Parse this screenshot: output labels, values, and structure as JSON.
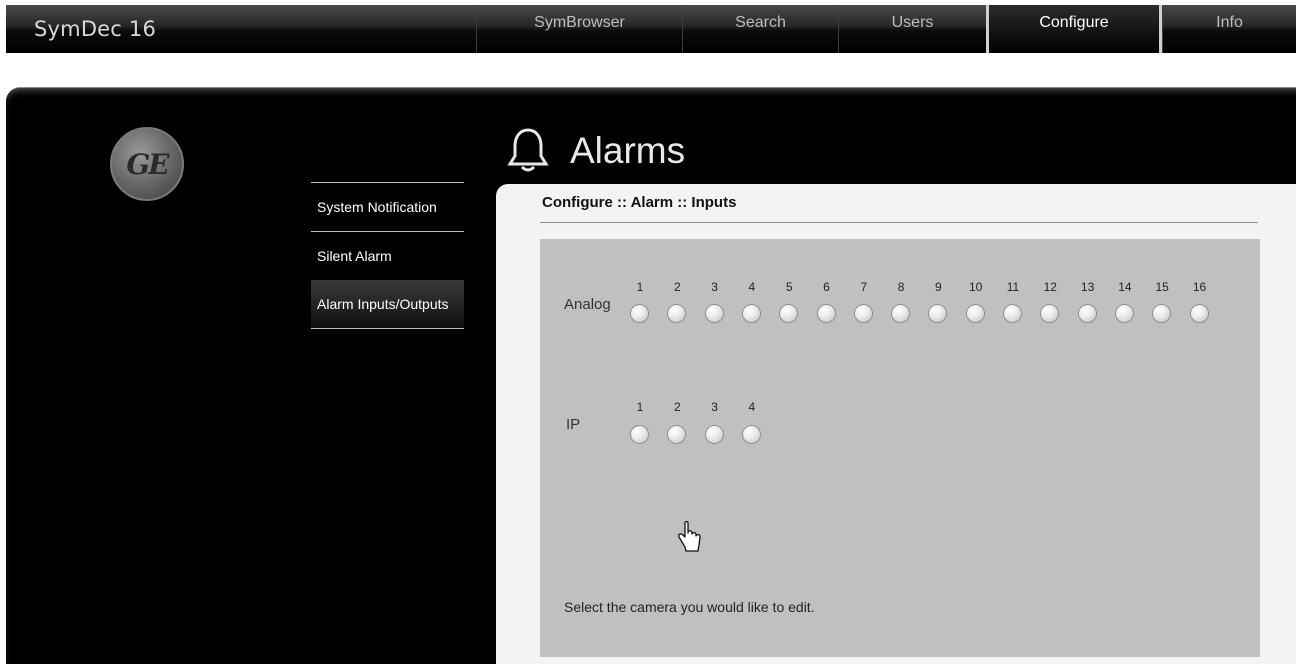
{
  "app": {
    "title": "SymDec 16"
  },
  "nav": {
    "tabs": [
      {
        "label": "SymBrowser"
      },
      {
        "label": "Search"
      },
      {
        "label": "Users"
      },
      {
        "label": "Configure",
        "active": true
      },
      {
        "label": "Info"
      }
    ]
  },
  "sidebar": {
    "items": [
      {
        "label": "System Notification"
      },
      {
        "label": "Silent Alarm"
      },
      {
        "label": "Alarm Inputs/Outputs",
        "active": true
      }
    ]
  },
  "page": {
    "heading": "Alarms",
    "breadcrumb": "Configure :: Alarm :: Inputs"
  },
  "alarm_inputs": {
    "analog": {
      "label": "Analog",
      "channels": [
        "1",
        "2",
        "3",
        "4",
        "5",
        "6",
        "7",
        "8",
        "9",
        "10",
        "11",
        "12",
        "13",
        "14",
        "15",
        "16"
      ]
    },
    "ip": {
      "label": "IP",
      "channels": [
        "1",
        "2",
        "3",
        "4"
      ]
    }
  },
  "hint": "Select the camera you would like to edit.",
  "colors": {
    "accent_active_tab_border": "#cfcfcf",
    "content_panel": "#c2bfc3",
    "background_dark": "#000000"
  },
  "icons": {
    "logo": "ge-logo",
    "heading_icon": "bell-icon",
    "cursor": "hand-pointer-cursor"
  }
}
